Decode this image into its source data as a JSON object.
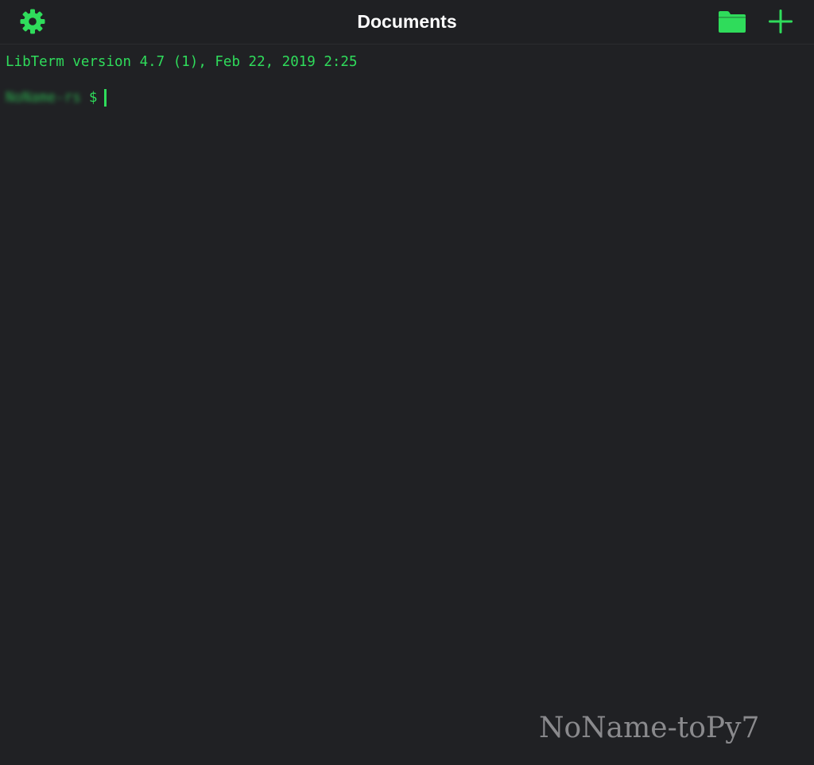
{
  "app": {
    "name": "LibTerm",
    "accent_color": "#2fdc5b",
    "background_color": "#202124"
  },
  "navbar": {
    "title": "Documents",
    "left_icon": "gear-icon",
    "right_icons": [
      "folder-icon",
      "plus-icon"
    ]
  },
  "terminal": {
    "version_line": "LibTerm version 4.7 (1), Feb 22, 2019 2:25",
    "prompt_user": "NoName-rs",
    "prompt_symbol": "$",
    "input_value": ""
  },
  "watermark": {
    "text": "NoName-toPy7"
  }
}
